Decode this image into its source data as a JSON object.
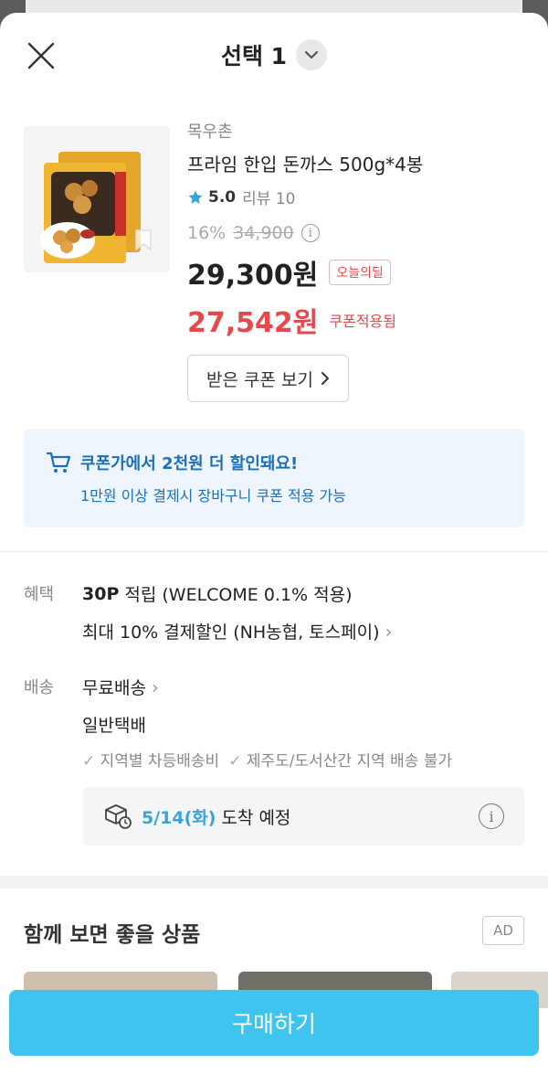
{
  "header": {
    "title": "선택 1",
    "close_icon": "close-icon",
    "dropdown_icon": "chevron-down-icon"
  },
  "product": {
    "brand": "목우촌",
    "name": "프라임 한입 돈까스 500g*4봉",
    "rating": "5.0",
    "review_label": "리뷰 10",
    "discount_rate": "16%",
    "original_price": "34,900",
    "price": "29,300원",
    "deal_badge": "오늘의딜",
    "coupon_price": "27,542원",
    "coupon_note": "쿠폰적용됨",
    "coupon_button": "받은 쿠폰 보기"
  },
  "banner": {
    "title": "쿠폰가에서 2천원 더 할인돼요!",
    "subtitle": "1만원 이상 결제시 장바구니 쿠폰 적용 가능"
  },
  "benefit": {
    "label": "혜택",
    "points_bold": "30P",
    "points_rest": "적립 (WELCOME 0.1% 적용)",
    "payment_discount": "최대 10% 결제할인 (NH농협, 토스페이)"
  },
  "shipping": {
    "label": "배송",
    "fee": "무료배송",
    "type": "일반택배",
    "notes": [
      "지역별 차등배송비",
      "제주도/도서산간 지역 배송 불가"
    ],
    "arrival_date": "5/14(화)",
    "arrival_text": "도착 예정"
  },
  "recommend": {
    "title": "함께 보면 좋을 상품",
    "ad_label": "AD"
  },
  "buy_button": "구매하기",
  "colors": {
    "accent": "#3fc4ef",
    "price_red": "#e5484d",
    "banner_blue": "#1c6fb8",
    "arrival_blue": "#3aa3d8"
  }
}
